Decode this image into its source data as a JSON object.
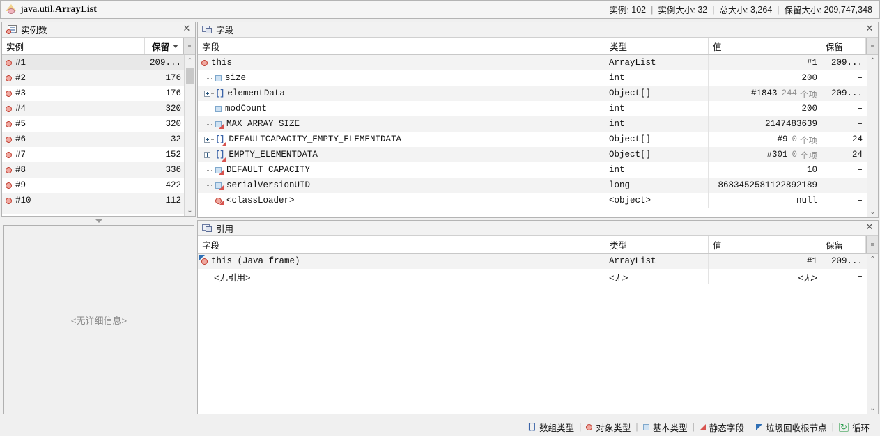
{
  "titlebar": {
    "icon": "app-class-icon",
    "class_name_prefix": "java.util.",
    "class_name": "ArrayList",
    "stats": [
      {
        "label": "实例:",
        "value": "102"
      },
      {
        "label": "实例大小:",
        "value": "32"
      },
      {
        "label": "总大小:",
        "value": "3,264"
      },
      {
        "label": "保留大小:",
        "value": "209,747,348"
      }
    ],
    "separator": "|"
  },
  "instances_panel": {
    "icon": "instances-icon",
    "title": "实例数",
    "close": "✕",
    "columns": [
      {
        "key": "instance",
        "label": "实例"
      },
      {
        "key": "retained",
        "label": "保留",
        "sorted": "desc"
      }
    ],
    "column_chooser_icon": "column-chooser-icon",
    "rows": [
      {
        "icon": "object-type-icon",
        "instance": "#1",
        "retained": "209..."
      },
      {
        "icon": "object-type-icon",
        "instance": "#2",
        "retained": "176"
      },
      {
        "icon": "object-type-icon",
        "instance": "#3",
        "retained": "176"
      },
      {
        "icon": "object-type-icon",
        "instance": "#4",
        "retained": "320"
      },
      {
        "icon": "object-type-icon",
        "instance": "#5",
        "retained": "320"
      },
      {
        "icon": "object-type-icon",
        "instance": "#6",
        "retained": "32"
      },
      {
        "icon": "object-type-icon",
        "instance": "#7",
        "retained": "152"
      },
      {
        "icon": "object-type-icon",
        "instance": "#8",
        "retained": "336"
      },
      {
        "icon": "object-type-icon",
        "instance": "#9",
        "retained": "422"
      },
      {
        "icon": "object-type-icon",
        "instance": "#10",
        "retained": "112"
      }
    ]
  },
  "detail_panel": {
    "empty_text": "<无详细信息>"
  },
  "fields_panel": {
    "icon": "fields-icon",
    "title": "字段",
    "close": "✕",
    "columns": [
      {
        "key": "field",
        "label": "字段"
      },
      {
        "key": "type",
        "label": "类型"
      },
      {
        "key": "value",
        "label": "值"
      },
      {
        "key": "retained",
        "label": "保留"
      }
    ],
    "column_chooser_icon": "column-chooser-icon",
    "rows": [
      {
        "depth": 0,
        "expander": "none",
        "icon": "object-type-icon",
        "static": false,
        "field": "this",
        "type": "ArrayList",
        "value": "#1",
        "count": "",
        "items_label": "",
        "retained": "209..."
      },
      {
        "depth": 1,
        "expander": "none",
        "icon": "primitive-type-icon",
        "static": false,
        "field": "size",
        "type": "int",
        "value": "200",
        "count": "",
        "items_label": "",
        "retained": "–"
      },
      {
        "depth": 1,
        "expander": "plus",
        "icon": "array-type-icon",
        "static": false,
        "field": "elementData",
        "type": "Object[]",
        "value": "#1843",
        "count": "244",
        "items_label": "个项",
        "retained": "209..."
      },
      {
        "depth": 1,
        "expander": "none",
        "icon": "primitive-type-icon",
        "static": false,
        "field": "modCount",
        "type": "int",
        "value": "200",
        "count": "",
        "items_label": "",
        "retained": "–"
      },
      {
        "depth": 1,
        "expander": "none",
        "icon": "primitive-type-icon",
        "static": true,
        "field": "MAX_ARRAY_SIZE",
        "type": "int",
        "value": "2147483639",
        "count": "",
        "items_label": "",
        "retained": "–"
      },
      {
        "depth": 1,
        "expander": "plus",
        "icon": "array-type-icon",
        "static": true,
        "field": "DEFAULTCAPACITY_EMPTY_ELEMENTDATA",
        "type": "Object[]",
        "value": "#9",
        "count": "0",
        "items_label": "个项",
        "retained": "24"
      },
      {
        "depth": 1,
        "expander": "plus",
        "icon": "array-type-icon",
        "static": true,
        "field": "EMPTY_ELEMENTDATA",
        "type": "Object[]",
        "value": "#301",
        "count": "0",
        "items_label": "个项",
        "retained": "24"
      },
      {
        "depth": 1,
        "expander": "none",
        "icon": "primitive-type-icon",
        "static": true,
        "field": "DEFAULT_CAPACITY",
        "type": "int",
        "value": "10",
        "count": "",
        "items_label": "",
        "retained": "–"
      },
      {
        "depth": 1,
        "expander": "none",
        "icon": "primitive-type-icon",
        "static": true,
        "field": "serialVersionUID",
        "type": "long",
        "value": "8683452581122892189",
        "count": "",
        "items_label": "",
        "retained": "–"
      },
      {
        "depth": 1,
        "expander": "none",
        "icon": "object-type-icon",
        "static": true,
        "field": "<classLoader>",
        "type": "<object>",
        "value": "null",
        "count": "",
        "items_label": "",
        "retained": "–"
      }
    ]
  },
  "references_panel": {
    "icon": "references-icon",
    "title": "引用",
    "close": "✕",
    "columns": [
      {
        "key": "field",
        "label": "字段"
      },
      {
        "key": "type",
        "label": "类型"
      },
      {
        "key": "value",
        "label": "值"
      },
      {
        "key": "retained",
        "label": "保留"
      }
    ],
    "column_chooser_icon": "column-chooser-icon",
    "rows": [
      {
        "depth": 0,
        "gcroot": true,
        "icon": "object-type-icon",
        "field": "this (Java frame)",
        "type": "ArrayList",
        "value": "#1",
        "retained": "209..."
      },
      {
        "depth": 1,
        "gcroot": false,
        "icon": "none",
        "field": "<无引用>",
        "type": "<无>",
        "value": "<无>",
        "retained": "–"
      }
    ]
  },
  "legend": {
    "separator": "|",
    "items": [
      {
        "icon": "array-type-icon",
        "label": "数组类型"
      },
      {
        "icon": "object-type-icon",
        "label": "对象类型"
      },
      {
        "icon": "primitive-type-icon",
        "label": "基本类型"
      },
      {
        "icon": "static-field-icon",
        "label": "静态字段"
      },
      {
        "icon": "gc-root-icon",
        "label": "垃圾回收根节点"
      },
      {
        "icon": "cycle-icon",
        "label": "循环"
      }
    ]
  },
  "colors": {
    "object_type": "#c0392b",
    "primitive_type": "#7fa8cc",
    "array_type": "#3a63a8",
    "static_marker": "#d8534f",
    "gc_root": "#2f6fb5",
    "cycle": "#2e9e4f",
    "row_alt": "#f3f3f3",
    "row_selected": "#e8e8e8"
  }
}
